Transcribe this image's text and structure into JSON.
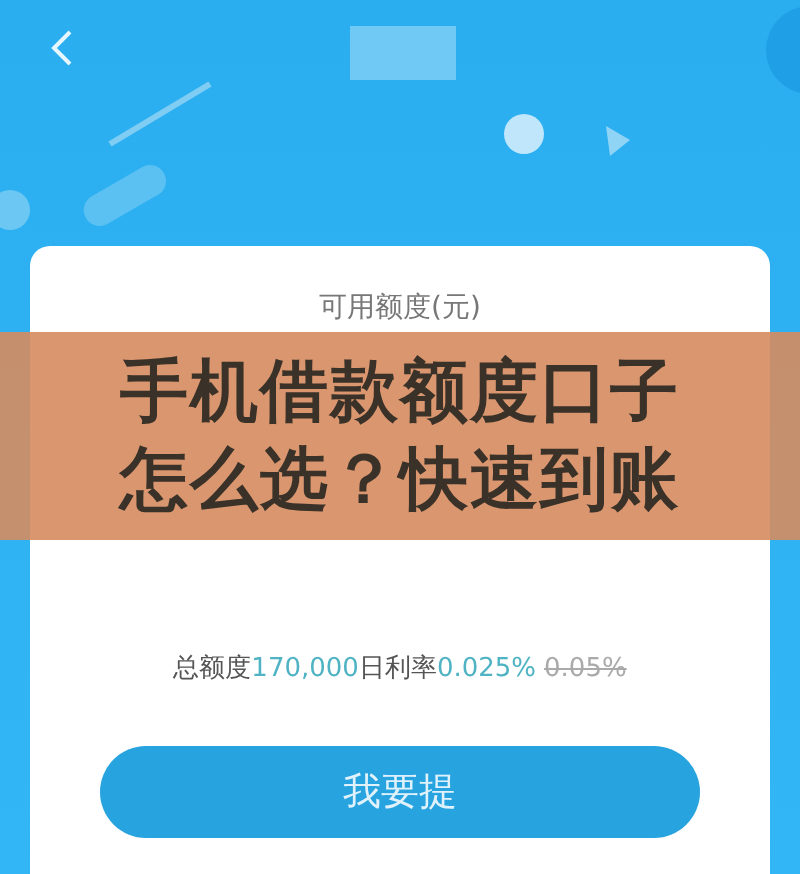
{
  "card": {
    "available_label": "可用额度(元)",
    "summary": [
      {
        "kind": "label",
        "text": "总额度"
      },
      {
        "kind": "value",
        "text": "170,000"
      },
      {
        "kind": "label",
        "text": "日利率"
      },
      {
        "kind": "value",
        "text": "0.025%"
      },
      {
        "kind": "old",
        "text": "0.05%"
      }
    ],
    "button": "我要提"
  },
  "overlay_title": [
    "手机借款额度口子",
    "怎么选？快速到账"
  ]
}
